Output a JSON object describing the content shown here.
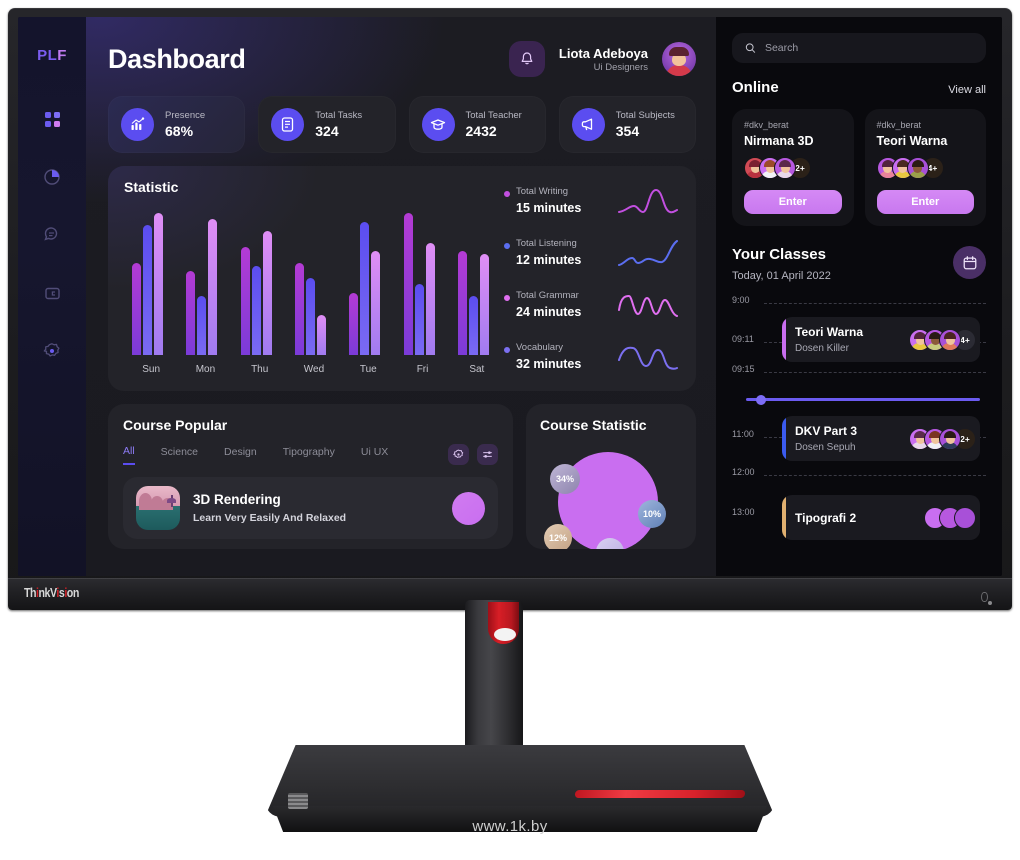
{
  "monitor": {
    "brand": "ThinkVision",
    "watermark": "www.1k.by"
  },
  "sidebar": {
    "logo": {
      "p": "PL",
      "f": "F"
    },
    "items": [
      {
        "name": "dashboard-grid",
        "icon": "grid-icon"
      },
      {
        "name": "analytics",
        "icon": "pie-chart-icon"
      },
      {
        "name": "messages",
        "icon": "chat-bubble-icon"
      },
      {
        "name": "library",
        "icon": "archive-icon"
      },
      {
        "name": "settings",
        "icon": "gear-icon"
      }
    ]
  },
  "header": {
    "title": "Dashboard",
    "notification_icon": "bell-icon",
    "user_name": "Liota Adeboya",
    "user_role": "Ui Designers"
  },
  "stats": [
    {
      "label": "Presence",
      "value": "68%",
      "icon": "chart-up-icon"
    },
    {
      "label": "Total Tasks",
      "value": "324",
      "icon": "document-icon"
    },
    {
      "label": "Total Teacher",
      "value": "2432",
      "icon": "graduation-cap-icon"
    },
    {
      "label": "Total Subjects",
      "value": "354",
      "icon": "megaphone-icon"
    }
  ],
  "statistic": {
    "title": "Statistic",
    "legend": [
      {
        "name": "Total Writing",
        "value": "15 minutes",
        "color": "#c24fe0"
      },
      {
        "name": "Total Listening",
        "value": "12 minutes",
        "color": "#5b6ef0"
      },
      {
        "name": "Total Grammar",
        "value": "24 minutes",
        "color": "#e06ff0"
      },
      {
        "name": "Vocabulary",
        "value": "32 minutes",
        "color": "#7b6ff0"
      }
    ]
  },
  "chart_data": {
    "type": "bar",
    "title": "Statistic",
    "categories": [
      "Sun",
      "Mon",
      "Thu",
      "Wed",
      "Tue",
      "Fri",
      "Sat"
    ],
    "series": [
      {
        "name": "Total Writing",
        "color": "#9b3bd8",
        "values": [
          62,
          57,
          73,
          62,
          42,
          96,
          70
        ]
      },
      {
        "name": "Total Listening",
        "color": "#5b4df0",
        "values": [
          88,
          40,
          60,
          52,
          90,
          48,
          40
        ]
      },
      {
        "name": "Vocabulary",
        "color": "#b58ef0",
        "values": [
          96,
          92,
          84,
          27,
          70,
          76,
          68
        ]
      }
    ],
    "ylim": [
      0,
      100
    ],
    "grid": false,
    "legend_position": "right"
  },
  "course_popular": {
    "title": "Course Popular",
    "tabs": [
      "All",
      "Science",
      "Design",
      "Tipography",
      "Ui UX"
    ],
    "active_tab": "All",
    "actions": [
      {
        "name": "settings",
        "icon": "gear-icon"
      },
      {
        "name": "filter",
        "icon": "sliders-icon"
      }
    ],
    "items": [
      {
        "name": "3D Rendering",
        "subtitle": "Learn Very Easily And Relaxed"
      }
    ]
  },
  "course_statistic": {
    "title": "Course Statistic",
    "chart_data": {
      "type": "pie",
      "title": "Course Statistic",
      "labels": [
        "34%",
        "10%",
        "12%"
      ],
      "values": [
        34,
        10,
        12
      ]
    },
    "bubbles": [
      {
        "label": "34%",
        "color": "#8d83ad"
      },
      {
        "label": "10%",
        "color": "#5f7fb5"
      },
      {
        "label": "12%",
        "color": "#c2a184"
      }
    ]
  },
  "right_panel": {
    "search_placeholder": "Search",
    "search_value": "",
    "search_icon": "search-icon",
    "online": {
      "title": "Online",
      "view_all": "View all",
      "cards": [
        {
          "tag": "#dkv_berat",
          "name": "Nirmana 3D",
          "more_count": "2+",
          "button": "Enter"
        },
        {
          "tag": "#dkv_berat",
          "name": "Teori Warna",
          "more_count": "4+",
          "button": "Enter"
        }
      ]
    },
    "classes": {
      "title": "Your Classes",
      "date": "Today, 01 April 2022",
      "calendar_icon": "calendar-icon",
      "times": [
        "9:00",
        "09:11",
        "09:15",
        "11:00",
        "12:00",
        "13:00"
      ],
      "events": [
        {
          "name": "Teori Warna",
          "teacher": "Dosen Killer",
          "more_count": "4+",
          "accent": "#c96ef0"
        },
        {
          "name": "DKV Part 3",
          "teacher": "Dosen Sepuh",
          "more_count": "2+",
          "accent": "#3b5bf0"
        },
        {
          "name": "Tipografi 2",
          "teacher": "",
          "more_count": "",
          "accent": "#e0b070"
        }
      ]
    }
  }
}
